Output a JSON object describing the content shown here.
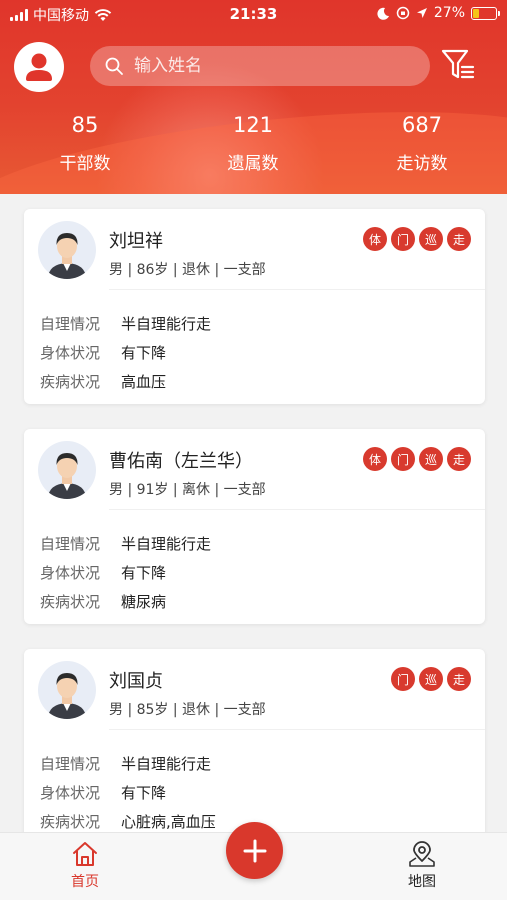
{
  "status_bar": {
    "carrier": "中国移动",
    "time": "21:33",
    "battery": "27%",
    "battery_level": 0.27
  },
  "header": {
    "search_placeholder": "输入姓名",
    "stats": [
      {
        "value": "85",
        "label": "干部数"
      },
      {
        "value": "121",
        "label": "遗属数"
      },
      {
        "value": "687",
        "label": "走访数"
      }
    ]
  },
  "records": [
    {
      "name": "刘坦祥",
      "meta": "男 | 86岁 | 退休 | 一支部",
      "tags": [
        "体",
        "门",
        "巡",
        "走"
      ],
      "fields": [
        {
          "key": "自理情况",
          "value": "半自理能行走"
        },
        {
          "key": "身体状况",
          "value": "有下降"
        },
        {
          "key": "疾病状况",
          "value": "高血压"
        }
      ]
    },
    {
      "name": "曹佑南（左兰华）",
      "meta": "男 | 91岁 | 离休 | 一支部",
      "tags": [
        "体",
        "门",
        "巡",
        "走"
      ],
      "fields": [
        {
          "key": "自理情况",
          "value": "半自理能行走"
        },
        {
          "key": "身体状况",
          "value": "有下降"
        },
        {
          "key": "疾病状况",
          "value": "糖尿病"
        }
      ]
    },
    {
      "name": "刘国贞",
      "meta": "男 | 85岁 | 退休 | 一支部",
      "tags": [
        "门",
        "巡",
        "走"
      ],
      "fields": [
        {
          "key": "自理情况",
          "value": "半自理能行走"
        },
        {
          "key": "身体状况",
          "value": "有下降"
        },
        {
          "key": "疾病状况",
          "value": "心脏病,高血压"
        }
      ]
    }
  ],
  "tabbar": {
    "home_label": "首页",
    "map_label": "地图"
  },
  "colors": {
    "brand_red": "#d9382c",
    "active_tab": "#d9382c"
  },
  "icons": {
    "search": "search-icon",
    "filter": "filter-icon",
    "avatar": "user-avatar-icon",
    "home": "home-icon",
    "map": "map-pin-icon",
    "add": "plus-icon"
  }
}
